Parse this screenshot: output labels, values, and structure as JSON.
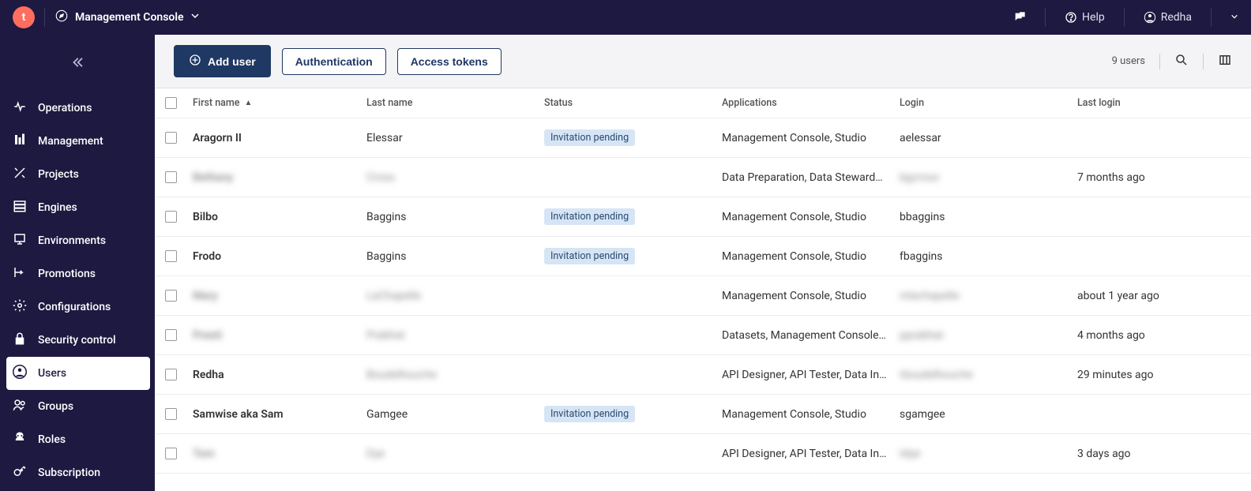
{
  "app_title": "Management Console",
  "user_name": "Redha",
  "help_label": "Help",
  "sidebar": {
    "items": [
      {
        "label": "Operations"
      },
      {
        "label": "Management"
      },
      {
        "label": "Projects"
      },
      {
        "label": "Engines"
      },
      {
        "label": "Environments"
      },
      {
        "label": "Promotions"
      },
      {
        "label": "Configurations"
      },
      {
        "label": "Security control"
      },
      {
        "label": "Users"
      },
      {
        "label": "Groups"
      },
      {
        "label": "Roles"
      },
      {
        "label": "Subscription"
      }
    ]
  },
  "toolbar": {
    "add_user": "Add user",
    "authentication": "Authentication",
    "access_tokens": "Access tokens",
    "count_label": "9 users"
  },
  "columns": {
    "first": "First name",
    "last": "Last name",
    "status": "Status",
    "apps": "Applications",
    "login": "Login",
    "last_login": "Last login"
  },
  "status_pending": "Invitation pending",
  "rows": [
    {
      "first": "Aragorn II",
      "last": "Elessar",
      "pending": true,
      "apps": "Management Console, Studio",
      "login": "aelessar",
      "last_login": "",
      "blur": false
    },
    {
      "first": "Bethany",
      "last": "Cross",
      "pending": false,
      "apps": "Data Preparation, Data Stewards...",
      "login": "bgcross",
      "last_login": "7 months ago",
      "blur": true
    },
    {
      "first": "Bilbo",
      "last": "Baggins",
      "pending": true,
      "apps": "Management Console, Studio",
      "login": "bbaggins",
      "last_login": "",
      "blur": false
    },
    {
      "first": "Frodo",
      "last": "Baggins",
      "pending": true,
      "apps": "Management Console, Studio",
      "login": "fbaggins",
      "last_login": "",
      "blur": false
    },
    {
      "first": "Mary",
      "last": "LaChapelle",
      "pending": false,
      "apps": "Management Console, Studio",
      "login": "mlachapelle",
      "last_login": "about 1 year ago",
      "blur": true
    },
    {
      "first": "Preeti",
      "last": "Prabhat",
      "pending": false,
      "apps": "Datasets, Management Console, ...",
      "login": "pprabhat",
      "last_login": "4 months ago",
      "blur": true
    },
    {
      "first": "Redha",
      "last": "Boudelhouche",
      "pending": false,
      "apps": "API Designer, API Tester, Data Inv...",
      "login": "rboudelhouche",
      "last_login": "29 minutes ago",
      "blur": true,
      "firstClear": true
    },
    {
      "first": "Samwise aka Sam",
      "last": "Gamgee",
      "pending": true,
      "apps": "Management Console, Studio",
      "login": "sgamgee",
      "last_login": "",
      "blur": false
    },
    {
      "first": "Tom",
      "last": "Dye",
      "pending": false,
      "apps": "API Designer, API Tester, Data Inv...",
      "login": "tdye",
      "last_login": "3 days ago",
      "blur": true
    }
  ]
}
